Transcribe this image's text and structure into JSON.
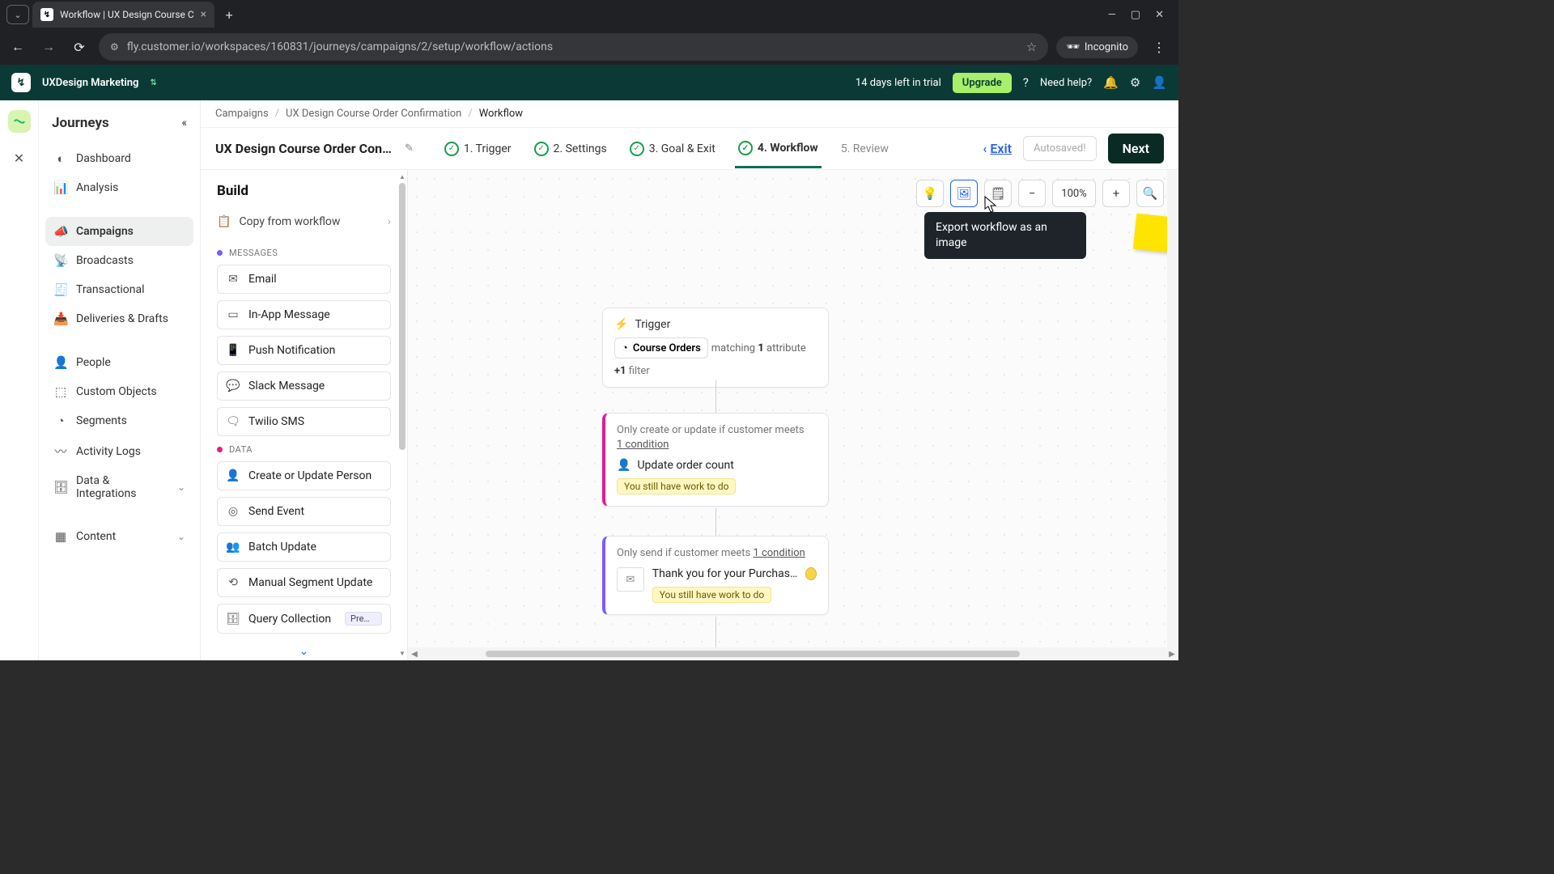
{
  "browser": {
    "tab_title": "Workflow | UX Design Course C",
    "url": "fly.customer.io/workspaces/160831/journeys/campaigns/2/setup/workflow/actions",
    "incognito": "Incognito"
  },
  "topbar": {
    "workspace": "UXDesign Marketing",
    "trial": "14 days left in trial",
    "upgrade": "Upgrade",
    "need_help": "Need help?"
  },
  "sidenav": {
    "title": "Journeys",
    "items": [
      {
        "label": "Dashboard"
      },
      {
        "label": "Analysis"
      },
      {
        "label": "Campaigns"
      },
      {
        "label": "Broadcasts"
      },
      {
        "label": "Transactional"
      },
      {
        "label": "Deliveries & Drafts"
      },
      {
        "label": "People"
      },
      {
        "label": "Custom Objects"
      },
      {
        "label": "Segments"
      },
      {
        "label": "Activity Logs"
      },
      {
        "label": "Data & Integrations"
      },
      {
        "label": "Content"
      }
    ]
  },
  "crumbs": {
    "a": "Campaigns",
    "b": "UX Design Course Order Confirmation",
    "c": "Workflow"
  },
  "page": {
    "title": "UX Design Course Order Confir…",
    "steps": {
      "s1": "1. Trigger",
      "s2": "2. Settings",
      "s3": "3. Goal & Exit",
      "s4": "4. Workflow",
      "s5": "5. Review"
    },
    "exit": "Exit",
    "autosaved": "Autosaved!",
    "next": "Next"
  },
  "build": {
    "title": "Build",
    "copy": "Copy from workflow",
    "grp_messages": "MESSAGES",
    "grp_data": "DATA",
    "messages": [
      {
        "label": "Email"
      },
      {
        "label": "In-App Message"
      },
      {
        "label": "Push Notification"
      },
      {
        "label": "Slack Message"
      },
      {
        "label": "Twilio SMS"
      }
    ],
    "data": [
      {
        "label": "Create or Update Person"
      },
      {
        "label": "Send Event"
      },
      {
        "label": "Batch Update"
      },
      {
        "label": "Manual Segment Update"
      },
      {
        "label": "Query Collection",
        "badge": "Premi…"
      }
    ]
  },
  "toolbar": {
    "tooltip": "Export workflow as an image",
    "zoom": "100%"
  },
  "nodes": {
    "trigger": {
      "title": "Trigger",
      "segment": "Course Orders",
      "matching_prefix": "matching",
      "matching_count": "1",
      "matching_suffix": "attribute",
      "filter_prefix": "+1",
      "filter_suffix": "filter"
    },
    "update": {
      "cond": "Only create or update if customer meets",
      "cond_link": "1 condition",
      "title": "Update order count",
      "warn": "You still have work to do"
    },
    "email": {
      "cond": "Only send if customer meets",
      "cond_link": "1 condition",
      "subject": "Thank you for your Purchas…",
      "warn": "You still have work to do"
    }
  }
}
